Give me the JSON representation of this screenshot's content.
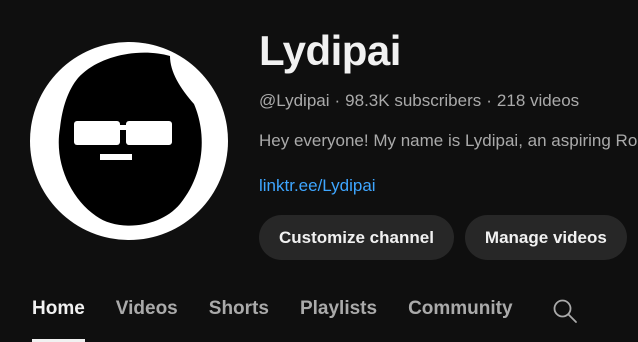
{
  "channel": {
    "name": "Lydipai",
    "handle": "@Lydipai",
    "subscribers": "98.3K subscribers",
    "videos": "218 videos",
    "separator": "·",
    "description": "Hey everyone! My name is Lydipai, an aspiring Roblox content creator",
    "link": "linktr.ee/Lydipai"
  },
  "actions": {
    "customize_label": "Customize channel",
    "manage_label": "Manage videos"
  },
  "tabs": [
    {
      "label": "Home",
      "active": true
    },
    {
      "label": "Videos",
      "active": false
    },
    {
      "label": "Shorts",
      "active": false
    },
    {
      "label": "Playlists",
      "active": false
    },
    {
      "label": "Community",
      "active": false
    }
  ],
  "icons": {
    "search": "search-icon"
  },
  "colors": {
    "background": "#0f0f0f",
    "text_primary": "#f1f1f1",
    "text_secondary": "#aaaaaa",
    "link": "#3ea6ff",
    "button_bg": "#272727"
  }
}
